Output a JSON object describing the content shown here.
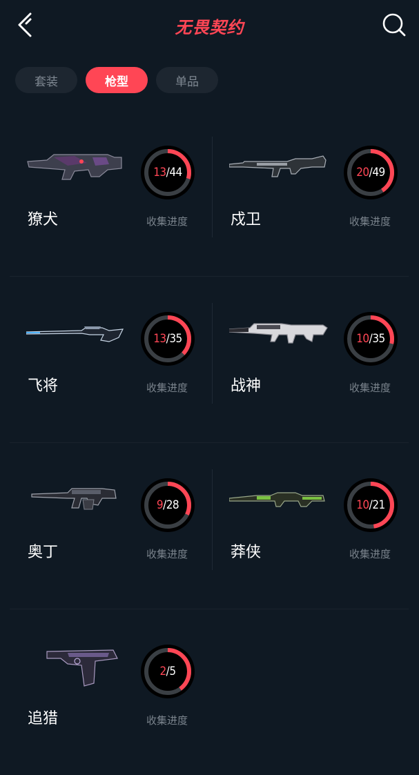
{
  "header": {
    "title": "无畏契约"
  },
  "tabs": [
    {
      "label": "套装",
      "active": false
    },
    {
      "label": "枪型",
      "active": true
    },
    {
      "label": "单品",
      "active": false
    }
  ],
  "progress_label": "收集进度",
  "colors": {
    "accent": "#ff4655",
    "background": "#0f1923",
    "ring_track": "#3a3f44"
  },
  "weapons": [
    {
      "name": "獠犬",
      "collected": 13,
      "total": 44,
      "icon": "smg-icon"
    },
    {
      "name": "戍卫",
      "collected": 20,
      "total": 49,
      "icon": "rifle-icon"
    },
    {
      "name": "飞将",
      "collected": 13,
      "total": 35,
      "icon": "sniper-icon"
    },
    {
      "name": "战神",
      "collected": 10,
      "total": 35,
      "icon": "rifle-icon"
    },
    {
      "name": "奥丁",
      "collected": 9,
      "total": 28,
      "icon": "machine-gun-icon"
    },
    {
      "name": "莽侠",
      "collected": 10,
      "total": 21,
      "icon": "rifle-icon"
    },
    {
      "name": "追猎",
      "collected": 2,
      "total": 5,
      "icon": "pistol-icon"
    }
  ]
}
